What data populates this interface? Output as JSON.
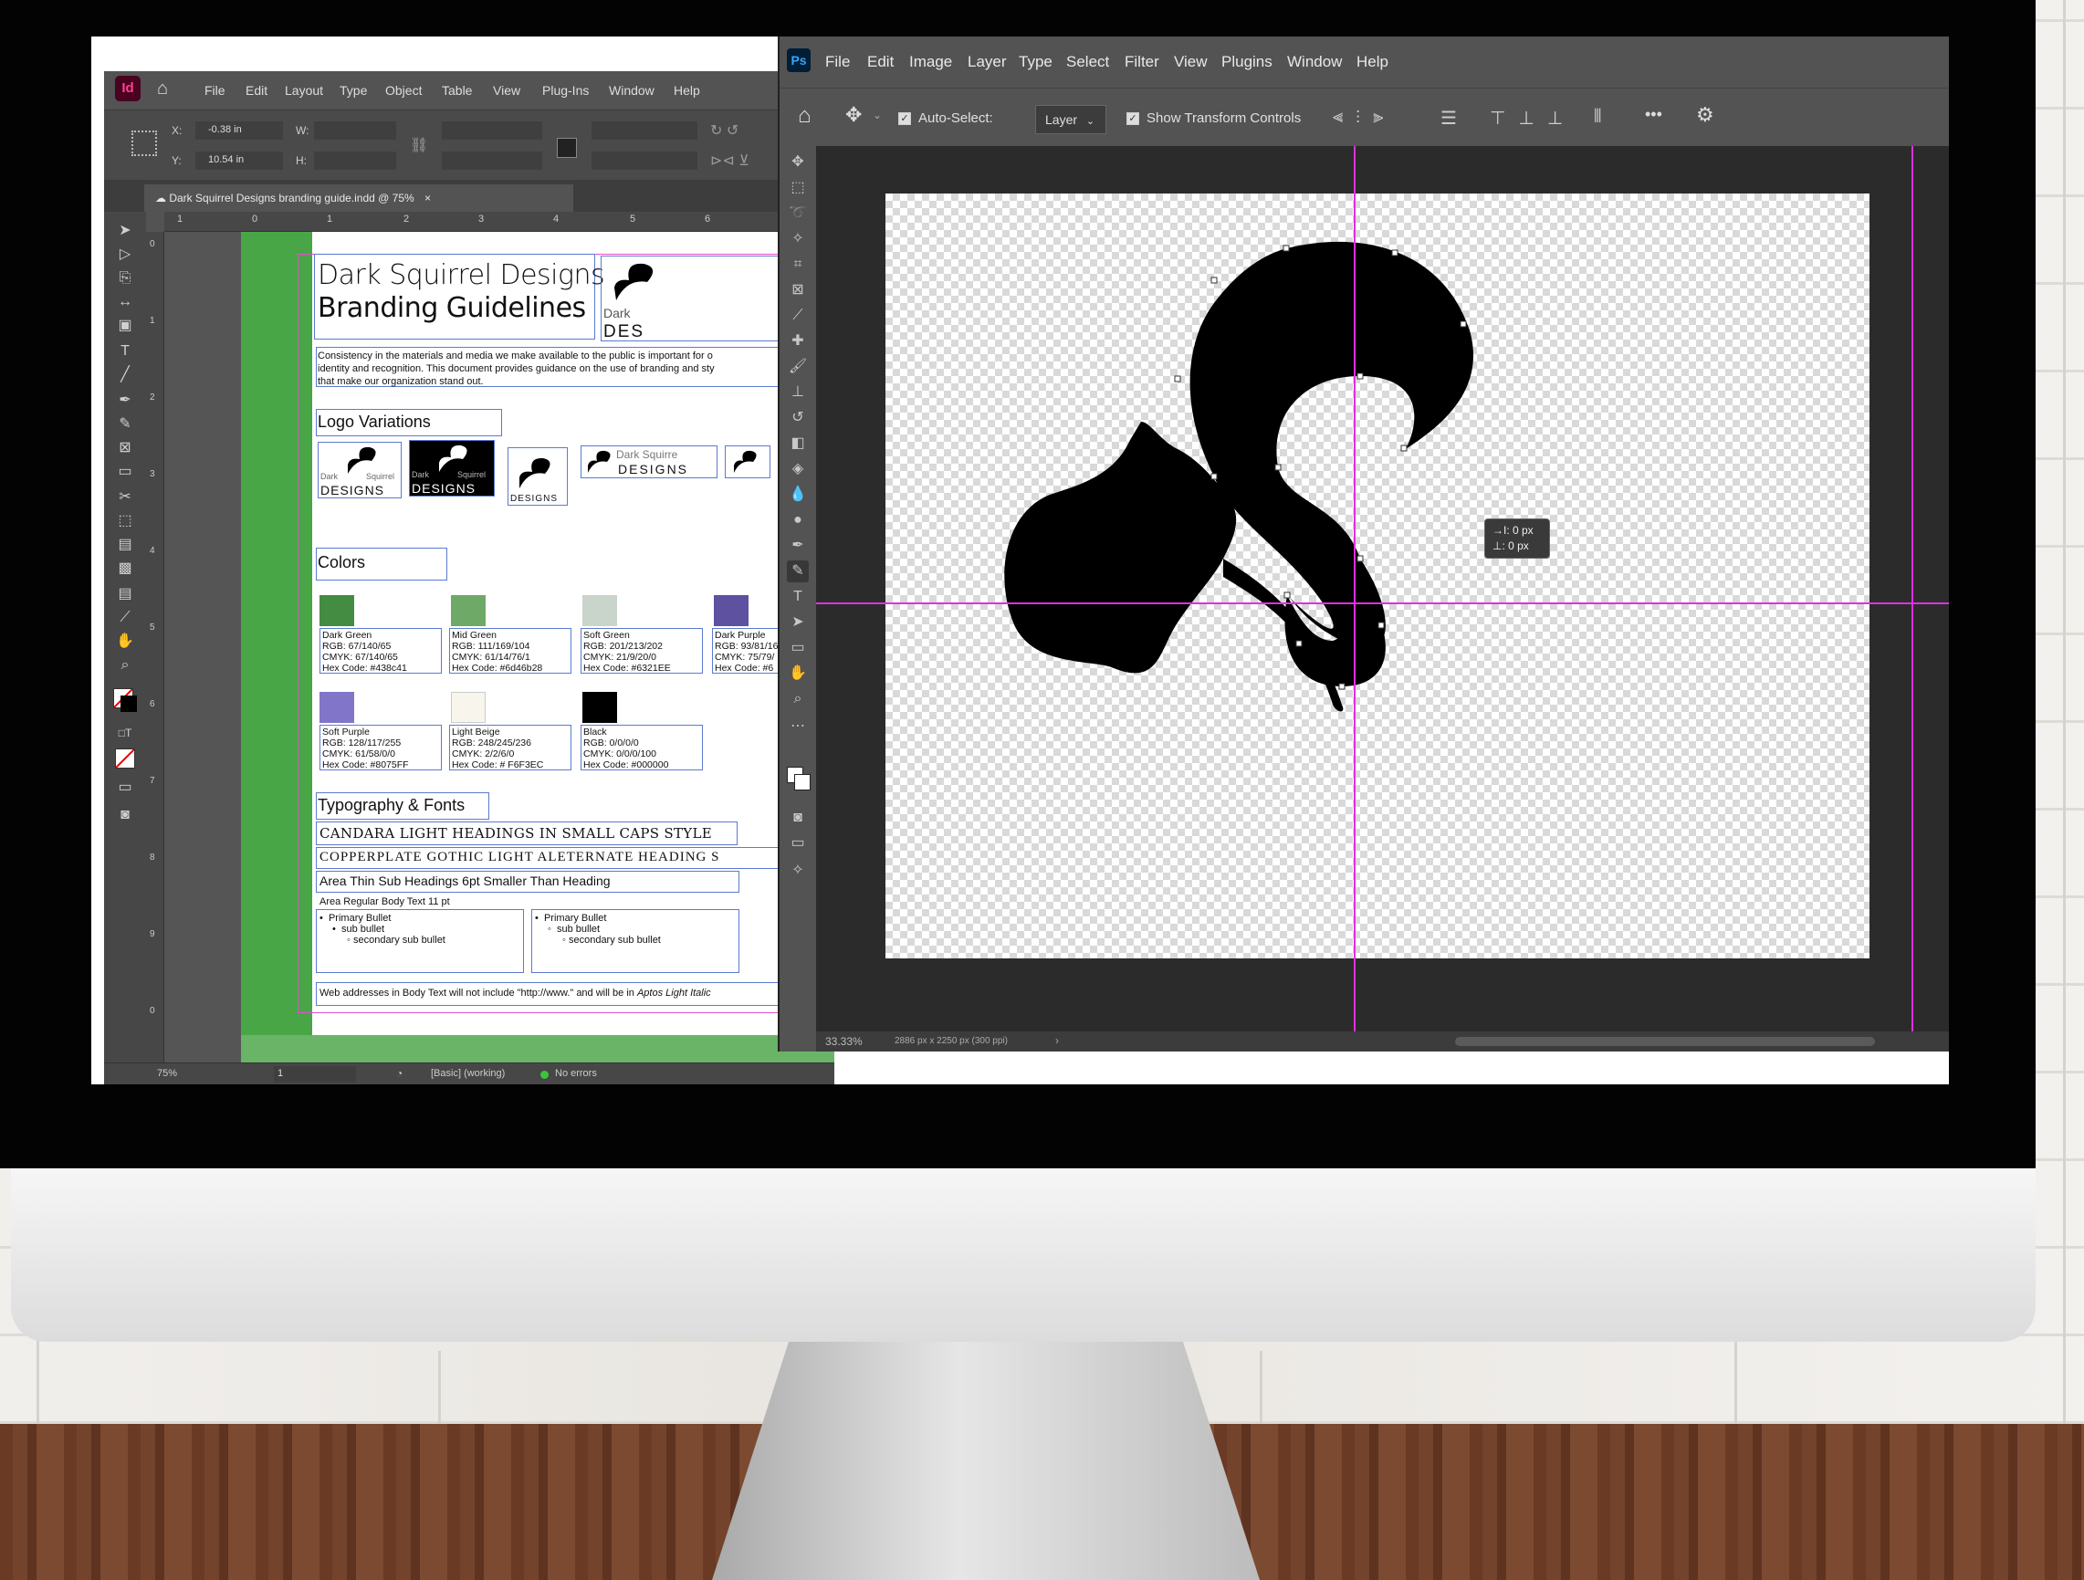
{
  "indesign": {
    "app_icon": "Id",
    "menu": [
      "File",
      "Edit",
      "Layout",
      "Type",
      "Object",
      "Table",
      "View",
      "Plug-Ins",
      "Window",
      "Help"
    ],
    "control": {
      "x_label": "X:",
      "x_value": "-0.38 in",
      "y_label": "Y:",
      "y_value": "10.54 in",
      "w_label": "W:",
      "h_label": "H:"
    },
    "tab_title": "Dark Squirrel Designs branding guide.indd @ 75%",
    "tab_close": "×",
    "ruler_marks": [
      "1",
      "0",
      "1",
      "2",
      "3",
      "4",
      "5",
      "6"
    ],
    "vruler_marks": [
      "0",
      "1",
      "2",
      "3",
      "4",
      "5",
      "6",
      "7",
      "8",
      "9",
      "0"
    ],
    "doc": {
      "title1": "Dark Squirrel Designs",
      "title2": "Branding Guidelines",
      "header_logo_line1": "Dark",
      "header_logo_line2": "DES",
      "intro_l1": "Consistency in the materials and media we make available to the public is important for o",
      "intro_l2": "identity and recognition. This document provides guidance on the use of branding and sty",
      "intro_l3": "that make our organization stand out.",
      "logo_heading": "Logo Variations",
      "logo_word_dark": "Dark",
      "logo_word_squirrel": "Squirrel",
      "logo_word_designs": "DESIGNS",
      "logo_wide_top": "Dark Squirre",
      "logo_wide_bottom": "DESIGNS",
      "colors_heading": "Colors",
      "colors": [
        {
          "name": "Dark Green",
          "rgb": "RGB: 67/140/65",
          "cmyk": "CMYK: 67/140/65",
          "hex": "Hex Code: #438c41",
          "color": "#438c41"
        },
        {
          "name": "Mid Green",
          "rgb": "RGB: 111/169/104",
          "cmyk": "CMYK: 61/14/76/1",
          "hex": "Hex Code: #6d46b28",
          "color": "#6fa968"
        },
        {
          "name": "Soft Green",
          "rgb": "RGB: 201/213/202",
          "cmyk": "CMYK: 21/9/20/0",
          "hex": "Hex Code: #6321EE",
          "color": "#c9d5ca"
        },
        {
          "name": "Dark Purple",
          "rgb": "RGB: 93/81/16",
          "cmyk": "CMYK: 75/79/",
          "hex": "Hex Code: #6",
          "color": "#5d51a0"
        },
        {
          "name": "Soft Purple",
          "rgb": "RGB: 128/117/255",
          "cmyk": "CMYK: 61/58/0/0",
          "hex": "Hex Code: #8075FF",
          "color": "#8075c8"
        },
        {
          "name": "Light Beige",
          "rgb": "RGB: 248/245/236",
          "cmyk": "CMYK: 2/2/6/0",
          "hex": "Hex Code: # F6F3EC",
          "color": "#f8f5ec"
        },
        {
          "name": "Black",
          "rgb": "RGB: 0/0/0/0",
          "cmyk": "CMYK: 0/0/0/100",
          "hex": "Hex Code: #000000",
          "color": "#000000"
        }
      ],
      "type_heading": "Typography & Fonts",
      "type_l1": "CANDARA LIGHT HEADINGS IN SMALL CAPS STYLE",
      "type_l2": "COPPERPLATE GOTHIC LIGHT ALETERNATE HEADING S",
      "type_l3": "Area Thin Sub Headings 6pt Smaller Than Heading",
      "type_l4": "Area Regular Body Text 11 pt",
      "bullet_primary": "Primary Bullet",
      "bullet_sub": "sub bullet",
      "bullet_secondary": "secondary sub bullet",
      "web_note_pre": "Web addresses in Body Text will not include \"http://www.\" and will be in ",
      "web_note_italic": "Aptos Light Italic"
    },
    "status": {
      "zoom": "75%",
      "page": "1",
      "preset": "[Basic] (working)",
      "preflight": "No errors"
    }
  },
  "photoshop": {
    "app_icon": "Ps",
    "menu": [
      "File",
      "Edit",
      "Image",
      "Layer",
      "Type",
      "Select",
      "Filter",
      "View",
      "Plugins",
      "Window",
      "Help"
    ],
    "options": {
      "auto_select": "Auto-Select:",
      "layer": "Layer",
      "transform": "Show Transform Controls",
      "more": "•••"
    },
    "tooltip": {
      "dx": "→I: 0 px",
      "dy": "⊥: 0 px"
    },
    "status": {
      "zoom": "33.33%",
      "dims": "2886 px x 2250 px (300 ppi)",
      "arrow": "›"
    }
  }
}
